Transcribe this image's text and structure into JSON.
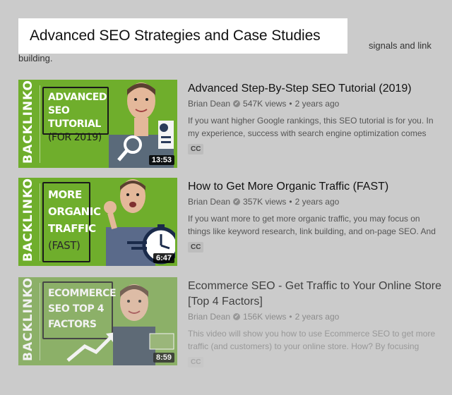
{
  "overlay_title": "Advanced SEO Strategies and Case Studies",
  "intro": {
    "tail": "signals and link",
    "line2": "building."
  },
  "videos": [
    {
      "title": "Advanced Step-By-Step SEO Tutorial (2019)",
      "channel": "Brian Dean",
      "views": "547K views",
      "age": "2 years ago",
      "description": "If you want higher Google rankings, this SEO tutorial is for you. In my experience, success with search engine optimization comes",
      "badge": "CC",
      "duration": "13:53",
      "thumb_brand": "BACKLINKO",
      "thumb_lines": [
        "ADVANCED",
        "SEO TUTORIAL",
        "(FOR 2019)"
      ]
    },
    {
      "title": "How to Get More Organic Traffic (FAST)",
      "channel": "Brian Dean",
      "views": "357K views",
      "age": "2 years ago",
      "description": "If you want more to get more organic traffic, you may focus on things like keyword research, link building, and on-page SEO. And",
      "badge": "CC",
      "duration": "6:47",
      "thumb_brand": "BACKLINKO",
      "thumb_lines": [
        "MORE",
        "ORGANIC",
        "TRAFFIC",
        "(FAST)"
      ]
    },
    {
      "title": "Ecommerce SEO - Get Traffic to Your Online Store [Top 4 Factors]",
      "channel": "Brian Dean",
      "views": "156K views",
      "age": "2 years ago",
      "description": "This video will show you how to use Ecommerce SEO to get more traffic (and customers) to your online store. How? By focusing",
      "badge": "CC",
      "duration": "8:59",
      "thumb_brand": "BACKLINKO",
      "thumb_lines": [
        "ECOMMERCE",
        "SEO TOP 4",
        "FACTORS"
      ]
    }
  ],
  "meta_separator": "•",
  "verified_icon": "verified-check-icon",
  "colors": {
    "thumb_green": "#6fae2c",
    "overlay_bg": "#cbcbcb",
    "card_bg": "#ffffff"
  }
}
